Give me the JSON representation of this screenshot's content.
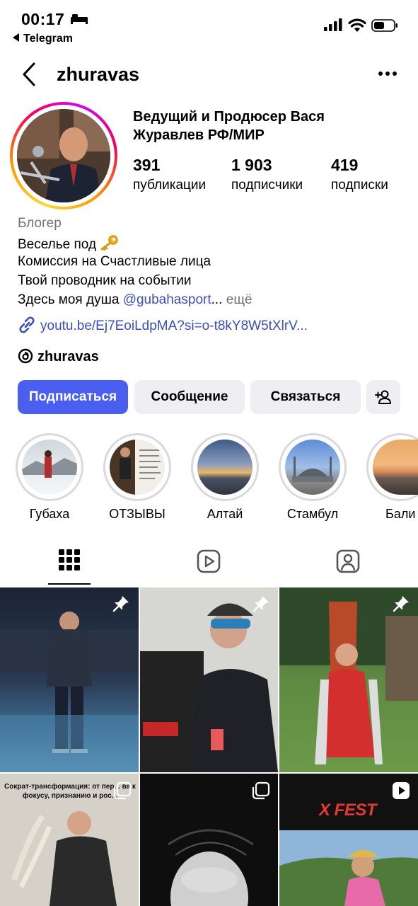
{
  "status_bar": {
    "time": "00:17",
    "back_app": "Telegram"
  },
  "header": {
    "username": "zhuravas"
  },
  "profile": {
    "display_name": "Ведущий и Продюсер Вася Журавлев РФ/МИР",
    "stats": [
      {
        "value": "391",
        "label": "публикации"
      },
      {
        "value": "1 903",
        "label": "подписчики"
      },
      {
        "value": "419",
        "label": "подписки"
      }
    ],
    "category": "Блогер",
    "bio_lines": [
      "Веселье под",
      "Комиссия на Счастливые лица",
      "Твой проводник на событии",
      "Здесь моя душа"
    ],
    "bio_mention": "@gubahasport",
    "bio_ellipsis": "...",
    "bio_more": "ещё",
    "link": "youtu.be/Ej7EoiLdpMA?si=o-t8kY8W5tXlrV...",
    "threads_handle": "zhuravas"
  },
  "buttons": {
    "follow": "Подписаться",
    "message": "Сообщение",
    "contact": "Связаться"
  },
  "highlights": [
    {
      "label": "Губаха"
    },
    {
      "label": "ОТЗЫВЫ"
    },
    {
      "label": "Алтай"
    },
    {
      "label": "Стамбул"
    },
    {
      "label": "Бали"
    }
  ],
  "grid": {
    "post_4_caption": "Сократ-трансформация: от пер... ва к фокусу, признанию и рос...",
    "post_6_caption": "X FEST"
  },
  "colors": {
    "primary_button": "#4a5ff0",
    "link": "#3a4fb8",
    "secondary_button": "#efeff3"
  }
}
